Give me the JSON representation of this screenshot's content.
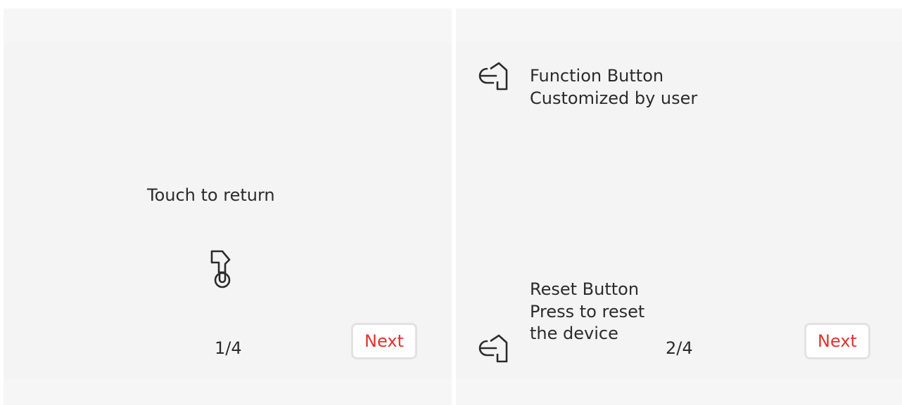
{
  "screens": [
    {
      "message": "Touch to return",
      "page_indicator": "1/4",
      "next_label": "Next",
      "icon": "tap-finger-icon"
    },
    {
      "function_button": {
        "title": "Function Button",
        "description": "Customized by user",
        "icon": "pointing-hand-icon"
      },
      "reset_button": {
        "title": "Reset Button",
        "description_line1": "Press to reset",
        "description_line2": "the device",
        "icon": "pointing-hand-icon"
      },
      "page_indicator": "2/4",
      "next_label": "Next"
    }
  ],
  "colors": {
    "panel_bg": "#f4f4f4",
    "text": "#2b2b2b",
    "accent": "#e2322d",
    "button_border": "#e2e2e2"
  }
}
